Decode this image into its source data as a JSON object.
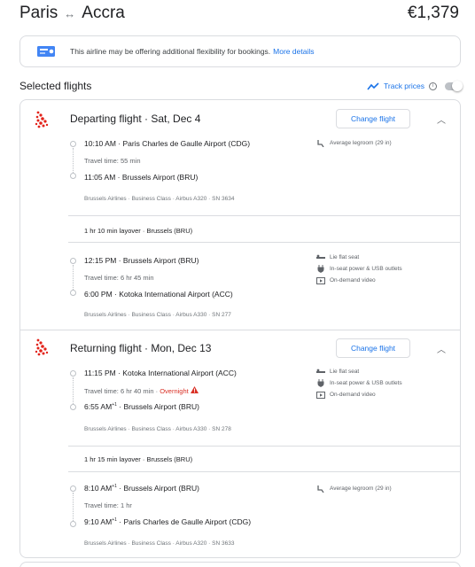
{
  "header": {
    "origin": "Paris",
    "swap_glyph": "↔",
    "destination": "Accra",
    "price": "€1,379"
  },
  "notice": {
    "text": "This airline may be offering additional flexibility for bookings.",
    "link": "More details"
  },
  "selected": {
    "title": "Selected flights",
    "track_label": "Track prices",
    "track_on": false
  },
  "departing": {
    "title": "Departing flight · Sat, Dec 4",
    "change_label": "Change flight",
    "leg1": {
      "depart": "10:10 AM  ·  Paris Charles de Gaulle Airport (CDG)",
      "travel_time": "Travel time: 55 min",
      "arrive": "11:05 AM  ·  Brussels Airport (BRU)",
      "meta": "Brussels Airlines  ·  Business Class  ·  Airbus A320  ·  SN 3634",
      "amenities": [
        {
          "icon": "legroom-icon",
          "text": "Average legroom (29 in)"
        }
      ]
    },
    "layover": "1 hr 10 min layover · Brussels (BRU)",
    "leg2": {
      "depart": "12:15 PM  ·  Brussels Airport (BRU)",
      "travel_time": "Travel time: 6 hr 45 min",
      "arrive": "6:00 PM  ·  Kotoka International Airport (ACC)",
      "meta": "Brussels Airlines  ·  Business Class  ·  Airbus A330  ·  SN 277",
      "amenities": [
        {
          "icon": "flat-seat-icon",
          "text": "Lie flat seat"
        },
        {
          "icon": "power-outlet-icon",
          "text": "In-seat power & USB outlets"
        },
        {
          "icon": "video-icon",
          "text": "On-demand video"
        }
      ]
    }
  },
  "returning": {
    "title": "Returning flight · Mon, Dec 13",
    "change_label": "Change flight",
    "leg1": {
      "depart": "11:15 PM  ·  Kotoka International Airport (ACC)",
      "travel_time": "Travel time: 6 hr 40 min  ·",
      "overnight": "Overnight",
      "arrive_time": "6:55 AM",
      "arrive_sup": "+1",
      "arrive_place": "  ·  Brussels Airport (BRU)",
      "meta": "Brussels Airlines  ·  Business Class  ·  Airbus A330  ·  SN 278",
      "amenities": [
        {
          "icon": "flat-seat-icon",
          "text": "Lie flat seat"
        },
        {
          "icon": "power-outlet-icon",
          "text": "In-seat power & USB outlets"
        },
        {
          "icon": "video-icon",
          "text": "On-demand video"
        }
      ]
    },
    "layover": "1 hr 15 min layover  ·  Brussels (BRU)",
    "leg2": {
      "depart_time": "8:10 AM",
      "depart_sup": "+1",
      "depart_place": "  ·  Brussels Airport (BRU)",
      "travel_time": "Travel time: 1 hr",
      "arrive_time": "9:10 AM",
      "arrive_sup": "+1",
      "arrive_place": "  ·  Paris Charles de Gaulle Airport (CDG)",
      "meta": "Brussels Airlines  ·  Business Class  ·  Airbus A320  ·  SN 3633",
      "amenities": [
        {
          "icon": "legroom-icon",
          "text": "Average legroom (29 in)"
        }
      ]
    }
  },
  "colors": {
    "accent": "#1a73e8",
    "warning": "#d93025",
    "border": "#dadce0",
    "airline_red": "#e2231a"
  }
}
